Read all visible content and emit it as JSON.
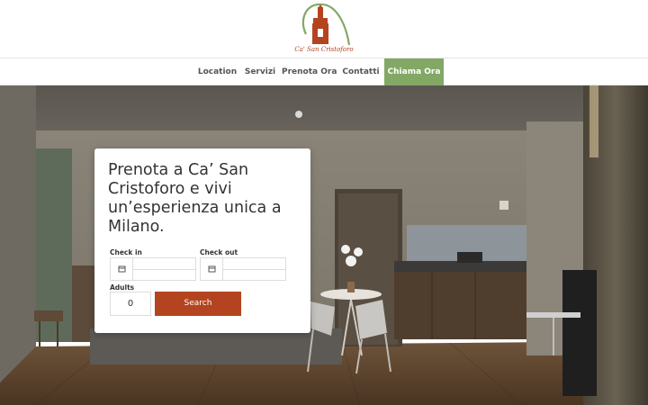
{
  "brand": {
    "name": "Ca' San Cristoforo"
  },
  "nav": {
    "items": [
      {
        "label": "Location"
      },
      {
        "label": "Servizi"
      },
      {
        "label": "Prenota Ora"
      },
      {
        "label": "Contatti"
      },
      {
        "label": "Chiama Ora"
      }
    ],
    "language": "english-flag-icon"
  },
  "booking": {
    "title": "Prenota a Ca’ San Cristoforo e vivi un’esperienza unica a Milano.",
    "checkin_label": "Check in",
    "checkout_label": "Check out",
    "adults_label": "Adults",
    "adults_value": "0",
    "search_label": "Search"
  },
  "colors": {
    "accent_green": "#83a866",
    "brand_rust": "#b4441f"
  }
}
